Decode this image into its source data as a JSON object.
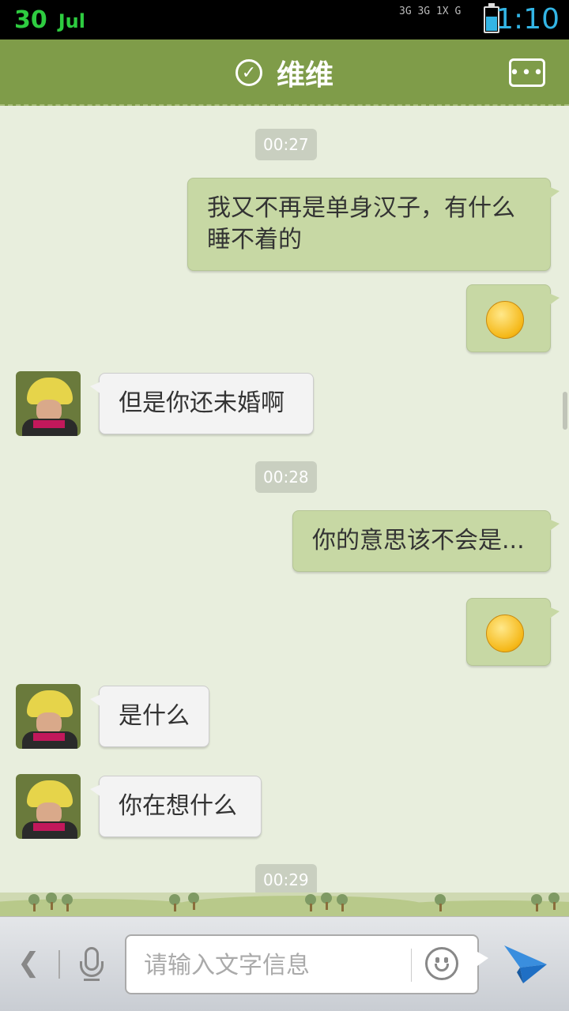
{
  "status_bar": {
    "date_day": "30",
    "date_month": "Jul",
    "network_text": "3G 3G 1X G",
    "time": "1:10"
  },
  "header": {
    "title": "维维",
    "verified_icon": "check-circle-icon",
    "more_icon": "chat-more-icon"
  },
  "messages": [
    {
      "type": "timestamp",
      "text": "00:27"
    },
    {
      "type": "text",
      "dir": "out",
      "text": "我又不再是单身汉子，有什么睡不着的"
    },
    {
      "type": "emoji",
      "dir": "out",
      "icon": "shy-emoji-icon"
    },
    {
      "type": "text",
      "dir": "in",
      "text": "但是你还未婚啊"
    },
    {
      "type": "timestamp",
      "text": "00:28"
    },
    {
      "type": "text",
      "dir": "out",
      "text": "你的意思该不会是..."
    },
    {
      "type": "emoji",
      "dir": "out",
      "icon": "smirk-emoji-icon"
    },
    {
      "type": "text",
      "dir": "in",
      "text": "是什么"
    },
    {
      "type": "text",
      "dir": "in",
      "text": "你在想什么"
    },
    {
      "type": "timestamp",
      "text": "00:29"
    }
  ],
  "input_bar": {
    "placeholder": "请输入文字信息",
    "back_icon": "chevron-left-icon",
    "mic_icon": "microphone-icon",
    "emoji_icon": "smiley-icon",
    "send_icon": "paper-plane-icon"
  },
  "colors": {
    "header": "#7f9c49",
    "chat_bg": "#e8eedd",
    "outgoing_bubble": "#c7d8a4",
    "incoming_bubble": "#f3f3f3",
    "time_accent": "#33b5e5",
    "date_accent": "#2ecc40"
  }
}
